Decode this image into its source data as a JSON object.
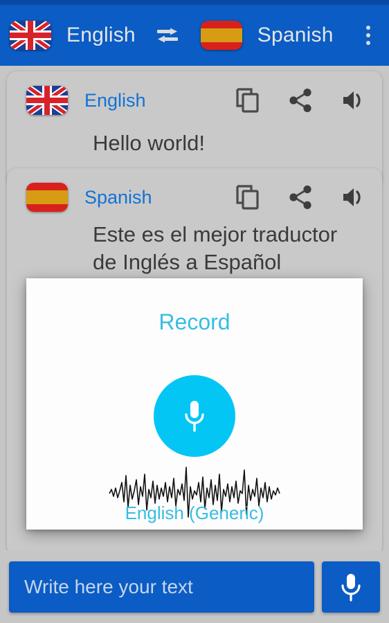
{
  "appbar": {
    "source_language": "English",
    "source_flag": "uk-flag-icon",
    "target_language": "Spanish",
    "target_flag": "spain-flag-icon",
    "swap_icon": "swap-arrows-icon",
    "overflow_icon": "more-vert-icon"
  },
  "cards": [
    {
      "flag": "uk-flag-icon",
      "language": "English",
      "text": "Hello world!",
      "actions": [
        "copy-icon",
        "share-icon",
        "speaker-icon"
      ]
    },
    {
      "flag": "spain-flag-icon",
      "language": "Spanish",
      "text": "Este es el mejor traductor de Inglés a Español",
      "actions": [
        "copy-icon",
        "share-icon",
        "speaker-icon"
      ]
    }
  ],
  "modal": {
    "title": "Record",
    "mic_icon": "microphone-icon",
    "waveform": "audio-waveform",
    "language_label": "English (Generic)"
  },
  "bottombar": {
    "input_placeholder": "Write here your text",
    "input_value": "",
    "mic_icon": "microphone-icon"
  },
  "colors": {
    "status_bar": "#0a48a8",
    "app_bar": "#0b5cc4",
    "page_background": "#c6c6c6",
    "card_background": "#c9c9c9",
    "language_link": "#1272d6",
    "accent_cyan": "#03c6f5",
    "modal_text": "#36bde3",
    "body_text": "#3a3a3a"
  }
}
